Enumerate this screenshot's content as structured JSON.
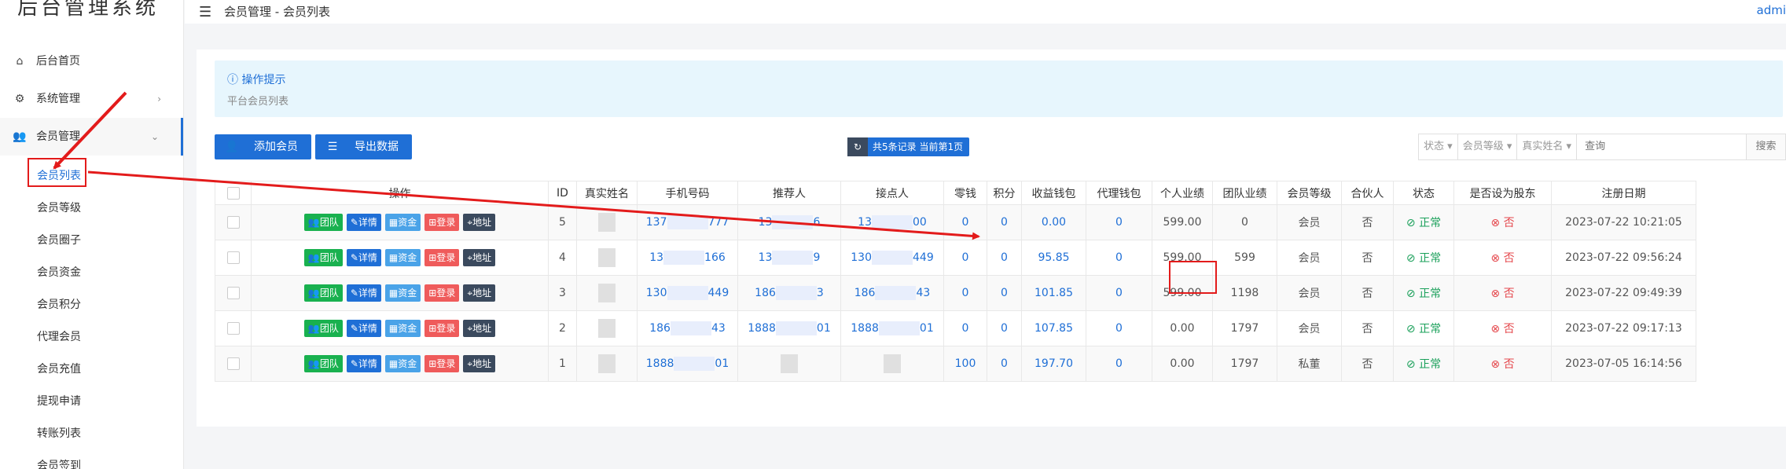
{
  "app": {
    "title": "后台管理系统"
  },
  "sidebar": {
    "items": [
      {
        "label": "后台首页",
        "icon": "home-icon"
      },
      {
        "label": "系统管理",
        "icon": "gear-icon"
      },
      {
        "label": "会员管理",
        "icon": "users-icon"
      }
    ],
    "sub_items": [
      "会员列表",
      "会员等级",
      "会员圈子",
      "会员资金",
      "会员积分",
      "代理会员",
      "会员充值",
      "提现申请",
      "转账列表",
      "会员签到"
    ]
  },
  "topbar": {
    "breadcrumb": "会员管理 - 会员列表",
    "user": "admi"
  },
  "tips": {
    "title": "操作提示",
    "desc": "平台会员列表"
  },
  "toolbar": {
    "add_label": "添加会员",
    "export_label": "导出数据",
    "record_text": "共5条记录 当前第1页"
  },
  "filters": {
    "status": "状态",
    "level": "会员等级",
    "realname": "真实姓名",
    "query_placeholder": "查询",
    "search_label": "搜索"
  },
  "table": {
    "headers": [
      "操作",
      "ID",
      "真实姓名",
      "手机号码",
      "推荐人",
      "接点人",
      "零钱",
      "积分",
      "收益钱包",
      "代理钱包",
      "个人业绩",
      "团队业绩",
      "会员等级",
      "合伙人",
      "状态",
      "是否设为股东",
      "注册日期"
    ],
    "action_labels": [
      "团队",
      "详情",
      "资金",
      "登录",
      "地址"
    ],
    "rows": [
      {
        "id": "5",
        "phone": [
          "137",
          "777"
        ],
        "referrer": [
          "13",
          "6"
        ],
        "node": [
          "13",
          "00"
        ],
        "change": "0",
        "points": "0",
        "income": "0.00",
        "agent": "0",
        "personal": "599.00",
        "team": "0",
        "level": "会员",
        "partner": "否",
        "status": "正常",
        "shareholder": "否",
        "date": "2023-07-22 10:21:05"
      },
      {
        "id": "4",
        "phone": [
          "13",
          "166"
        ],
        "referrer": [
          "13",
          "9"
        ],
        "node": [
          "130",
          "449"
        ],
        "change": "0",
        "points": "0",
        "income": "95.85",
        "agent": "0",
        "personal": "599.00",
        "team": "599",
        "level": "会员",
        "partner": "否",
        "status": "正常",
        "shareholder": "否",
        "date": "2023-07-22 09:56:24"
      },
      {
        "id": "3",
        "phone": [
          "130",
          "449"
        ],
        "referrer": [
          "186",
          "3"
        ],
        "node": [
          "186",
          "43"
        ],
        "change": "0",
        "points": "0",
        "income": "101.85",
        "agent": "0",
        "personal": "599.00",
        "team": "1198",
        "level": "会员",
        "partner": "否",
        "status": "正常",
        "shareholder": "否",
        "date": "2023-07-22 09:49:39"
      },
      {
        "id": "2",
        "phone": [
          "186",
          "43"
        ],
        "referrer": [
          "1888",
          "01"
        ],
        "node": [
          "1888",
          "01"
        ],
        "change": "0",
        "points": "0",
        "income": "107.85",
        "agent": "0",
        "personal": "0.00",
        "team": "1797",
        "level": "会员",
        "partner": "否",
        "status": "正常",
        "shareholder": "否",
        "date": "2023-07-22 09:17:13"
      },
      {
        "id": "1",
        "phone": [
          "1888",
          "01"
        ],
        "referrer": [
          "",
          ""
        ],
        "node": [
          "",
          ""
        ],
        "change": "100",
        "points": "0",
        "income": "197.70",
        "agent": "0",
        "personal": "0.00",
        "team": "1797",
        "level": "私董",
        "partner": "否",
        "status": "正常",
        "shareholder": "否",
        "date": "2023-07-05 16:14:56"
      }
    ]
  },
  "colors": {
    "primary": "#1f6fd6",
    "success": "#19b14f",
    "danger": "#ef5b5b",
    "dark": "#3b4a5e",
    "annotation": "#e31b1b"
  }
}
